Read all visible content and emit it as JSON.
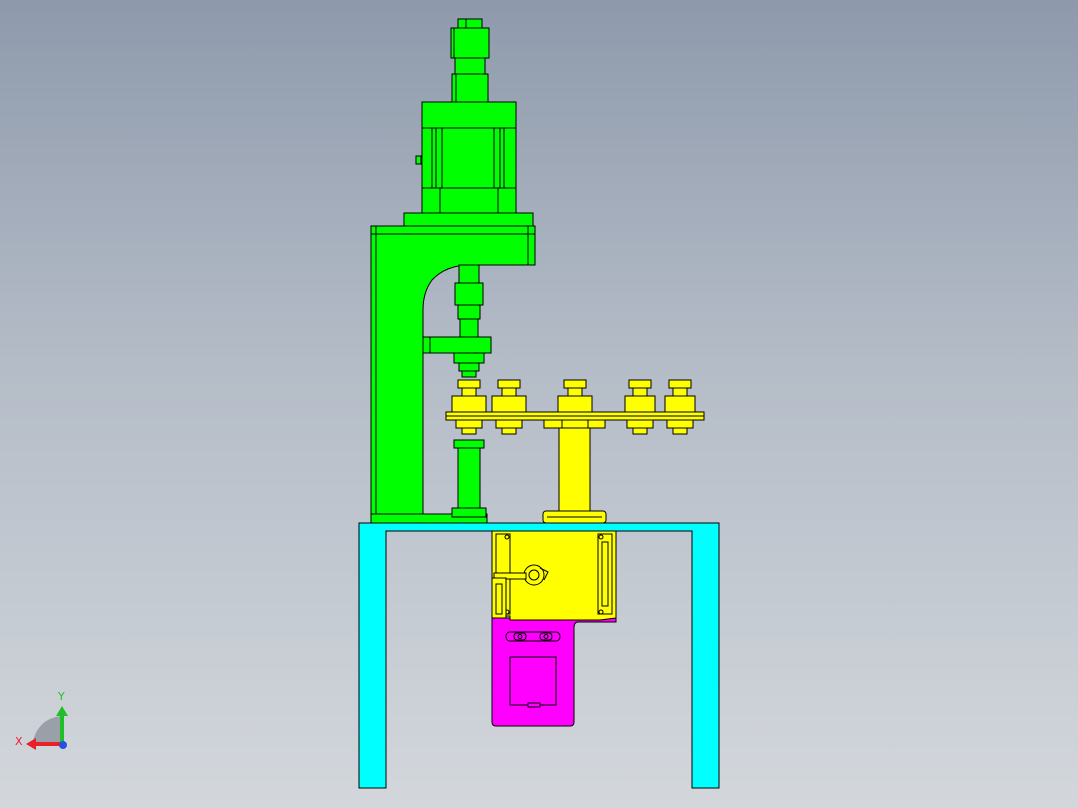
{
  "viewport": {
    "background_top": "#8e9aac",
    "background_bottom": "#d3d7dc"
  },
  "colors": {
    "press_body": "#00ff00",
    "turntable": "#ffff00",
    "frame": "#00ffff",
    "base_box": "#ff00ff",
    "outline": "#000000"
  },
  "triad": {
    "x_label": "X",
    "y_label": "Y",
    "x_color": "#e8202a",
    "y_color": "#1fbf2a",
    "z_color": "#2a4fe0"
  }
}
